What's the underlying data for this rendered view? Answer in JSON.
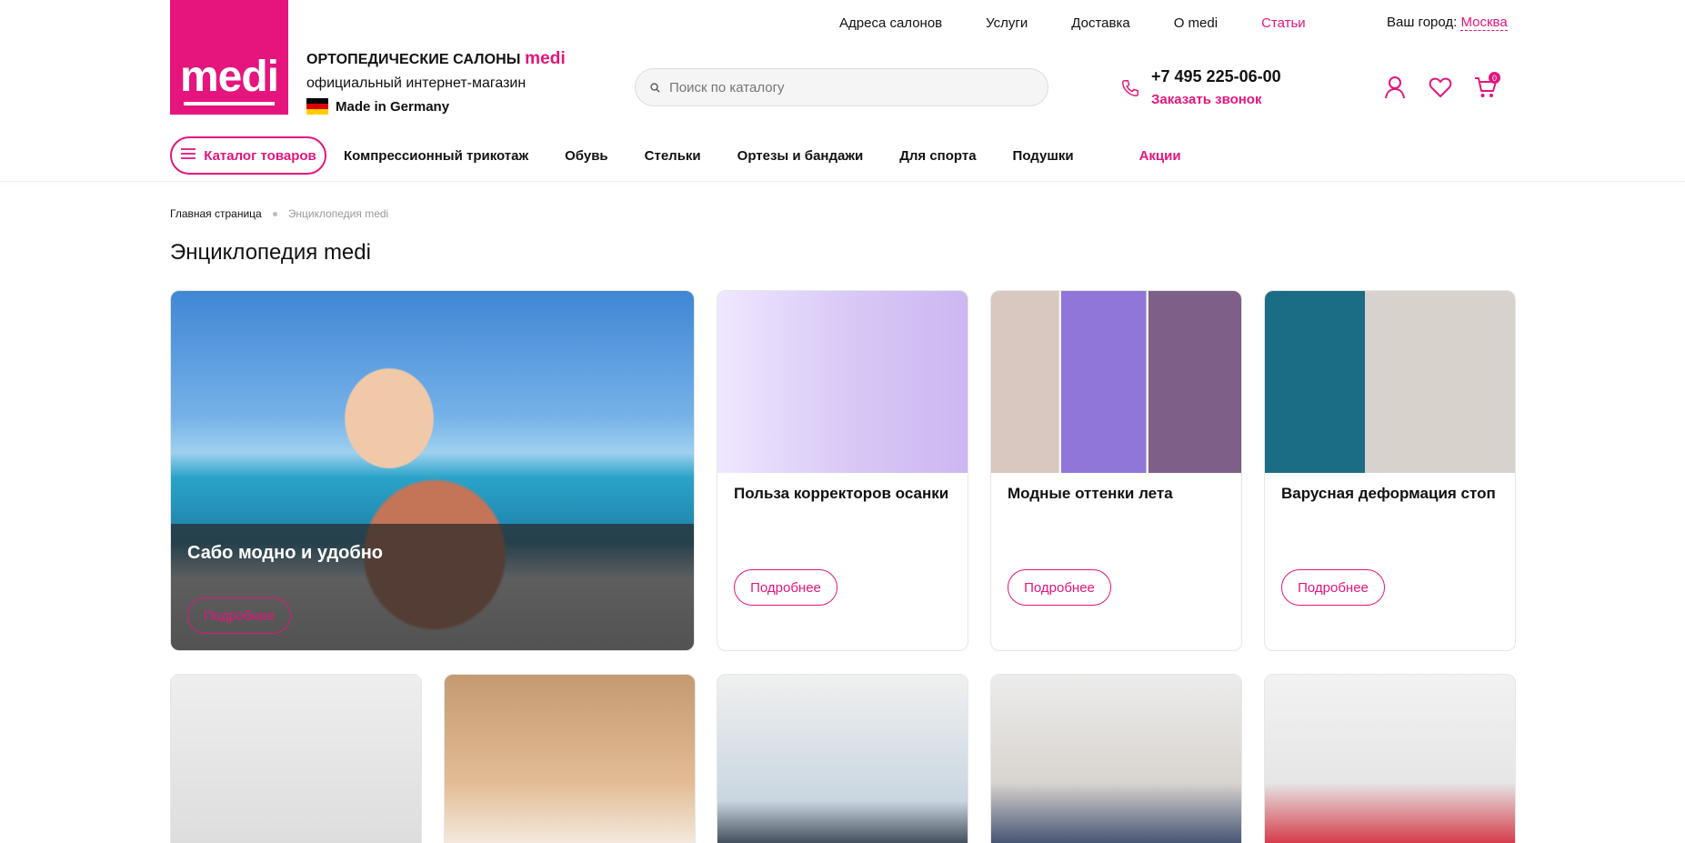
{
  "brand": {
    "logo_text": "medi",
    "color": "#e5157d"
  },
  "tagline": {
    "line1": "ОРТОПЕДИЧЕСКИЕ САЛОНЫ",
    "line1_brand": "medi",
    "line2": "официальный интернет-магазин",
    "line3": "Made in Germany"
  },
  "top_nav": [
    "Адреса салонов",
    "Услуги",
    "Доставка",
    "О medi",
    "Статьи"
  ],
  "city": {
    "label": "Ваш город:",
    "name": "Москва"
  },
  "search": {
    "placeholder": "Поиск по каталогу"
  },
  "contact": {
    "phone": "+7 495 225-06-00",
    "callback": "Заказать звонок"
  },
  "cart": {
    "count": "0"
  },
  "catalog_button": "Каталог товаров",
  "categories": [
    "Компрессионный трикотаж",
    "Обувь",
    "Стельки",
    "Ортезы и бандажи",
    "Для спорта",
    "Подушки",
    "Акции"
  ],
  "breadcrumb": {
    "home": "Главная страница",
    "current": "Энциклопедия medi"
  },
  "page_title": "Энциклопедия medi",
  "more_label": "Подробнее",
  "articles": [
    {
      "title": "Сабо модно и удобно"
    },
    {
      "title": "Польза корректоров осанки"
    },
    {
      "title": "Модные оттенки лета"
    },
    {
      "title": "Варусная деформация стоп"
    }
  ]
}
